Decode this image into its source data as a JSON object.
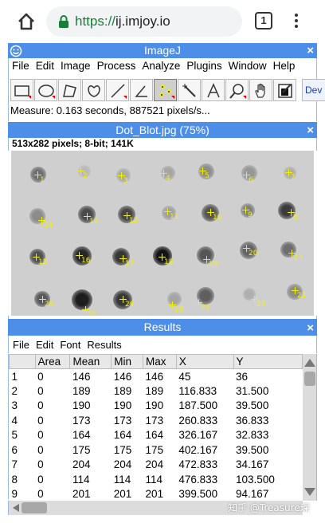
{
  "browser": {
    "url_protocol": "https://",
    "url_host": "ij.imjoy.io",
    "tab_count": "1",
    "icons": [
      "home-icon",
      "lock-icon",
      "tab-switcher-icon",
      "more-options-icon"
    ]
  },
  "imagej": {
    "title": "ImageJ",
    "close": "×",
    "menu": [
      "File",
      "Edit",
      "Image",
      "Process",
      "Analyze",
      "Plugins",
      "Window",
      "Help"
    ],
    "tools": [
      "rectangle-tool-icon",
      "oval-tool-icon",
      "polygon-tool-icon",
      "freehand-tool-icon",
      "line-tool-icon",
      "angle-tool-icon",
      "multipoint-tool-icon",
      "wand-tool-icon",
      "text-tool-icon",
      "magnifier-tool-icon",
      "hand-tool-icon",
      "color-picker-icon"
    ],
    "dev_label": "Dev",
    "status": "Measure: 0.163 seconds, 887521 pixels/s..."
  },
  "image_window": {
    "title": "Dot_Blot.jpg (75%)",
    "close": "×",
    "info": "513x282 pixels; 8-bit; 141K",
    "markers": [
      "1",
      "2",
      "3",
      "4",
      "5",
      "6",
      "7",
      "8",
      "9",
      "10",
      "11",
      "12",
      "13",
      "14",
      "15",
      "16",
      "17",
      "18",
      "19",
      "20",
      "21",
      "22",
      "23",
      "24",
      "25",
      "26",
      "27",
      "28"
    ]
  },
  "results": {
    "title": "Results",
    "close": "×",
    "menu": [
      "File",
      "Edit",
      "Font",
      "Results"
    ],
    "columns": [
      "",
      "Area",
      "Mean",
      "Min",
      "Max",
      "X",
      "Y"
    ],
    "rows": [
      [
        "1",
        "0",
        "146",
        "146",
        "146",
        "45",
        "36"
      ],
      [
        "2",
        "0",
        "189",
        "189",
        "189",
        "116.833",
        "31.500"
      ],
      [
        "3",
        "0",
        "190",
        "190",
        "190",
        "187.500",
        "39.500"
      ],
      [
        "4",
        "0",
        "173",
        "173",
        "173",
        "260.833",
        "36.833"
      ],
      [
        "5",
        "0",
        "164",
        "164",
        "164",
        "326.167",
        "32.833"
      ],
      [
        "6",
        "0",
        "175",
        "175",
        "175",
        "402.167",
        "39.500"
      ],
      [
        "7",
        "0",
        "204",
        "204",
        "204",
        "472.833",
        "34.167"
      ],
      [
        "8",
        "0",
        "114",
        "114",
        "114",
        "476.833",
        "103.500"
      ],
      [
        "9",
        "0",
        "201",
        "201",
        "201",
        "399.500",
        "94.167"
      ]
    ]
  },
  "watermark": "知乎 @Treasure琛",
  "colors": {
    "titlebar": "#4d8ee9",
    "marker": "#f2f200",
    "url_protocol": "#188038"
  }
}
